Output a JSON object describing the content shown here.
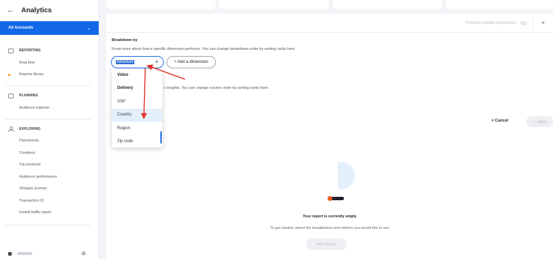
{
  "app": {
    "back_icon": "arrow-left-icon",
    "title": "Analytics"
  },
  "account": {
    "label": "All Accounts",
    "chevron": "⌄"
  },
  "sidebar": {
    "reporting": {
      "label": "REPORTING",
      "items": [
        "Real time",
        "Reports library"
      ]
    },
    "planning": {
      "label": "PLANNING",
      "items": [
        "Audience explorer"
      ]
    },
    "exploring": {
      "label": "EXPLORING",
      "items": [
        "Placements",
        "Creatives",
        "Top products",
        "Audience performance",
        "Shopper journey",
        "Transaction ID",
        "Invalid traffic report"
      ]
    },
    "collapse_icon": "⊞"
  },
  "header": {
    "comparison_label": "Previous period comparison",
    "close": "×"
  },
  "breakdown": {
    "title": "Breakdown by",
    "description": "Know more about how a specific dimension performs. You can change breakdown order by sorting cards here.",
    "selected_chip": "Advertiser",
    "chip_remove": "×",
    "add_dimension": "+ Add a dimension"
  },
  "metrics": {
    "description": "s insights. You can change column order by sorting cards here."
  },
  "dropdown": {
    "items": [
      {
        "label": "Video",
        "type": "head"
      },
      {
        "label": "Delivery",
        "type": "head"
      },
      {
        "label": "SSP",
        "type": "option"
      },
      {
        "label": "Country",
        "type": "active"
      },
      {
        "label": "Region",
        "type": "option"
      },
      {
        "label": "Zip code",
        "type": "option"
      }
    ]
  },
  "actions": {
    "cancel": "× Cancel",
    "apply": "✓ Apply"
  },
  "empty_state": {
    "title": "Your report is currently empty",
    "description": "To get started, select the breakdowns and metrics you would like to see",
    "button": "Add metrics"
  },
  "colors": {
    "accent": "#1368e8",
    "annotation": "#e0342c",
    "illustration_orange": "#f05a1c"
  }
}
